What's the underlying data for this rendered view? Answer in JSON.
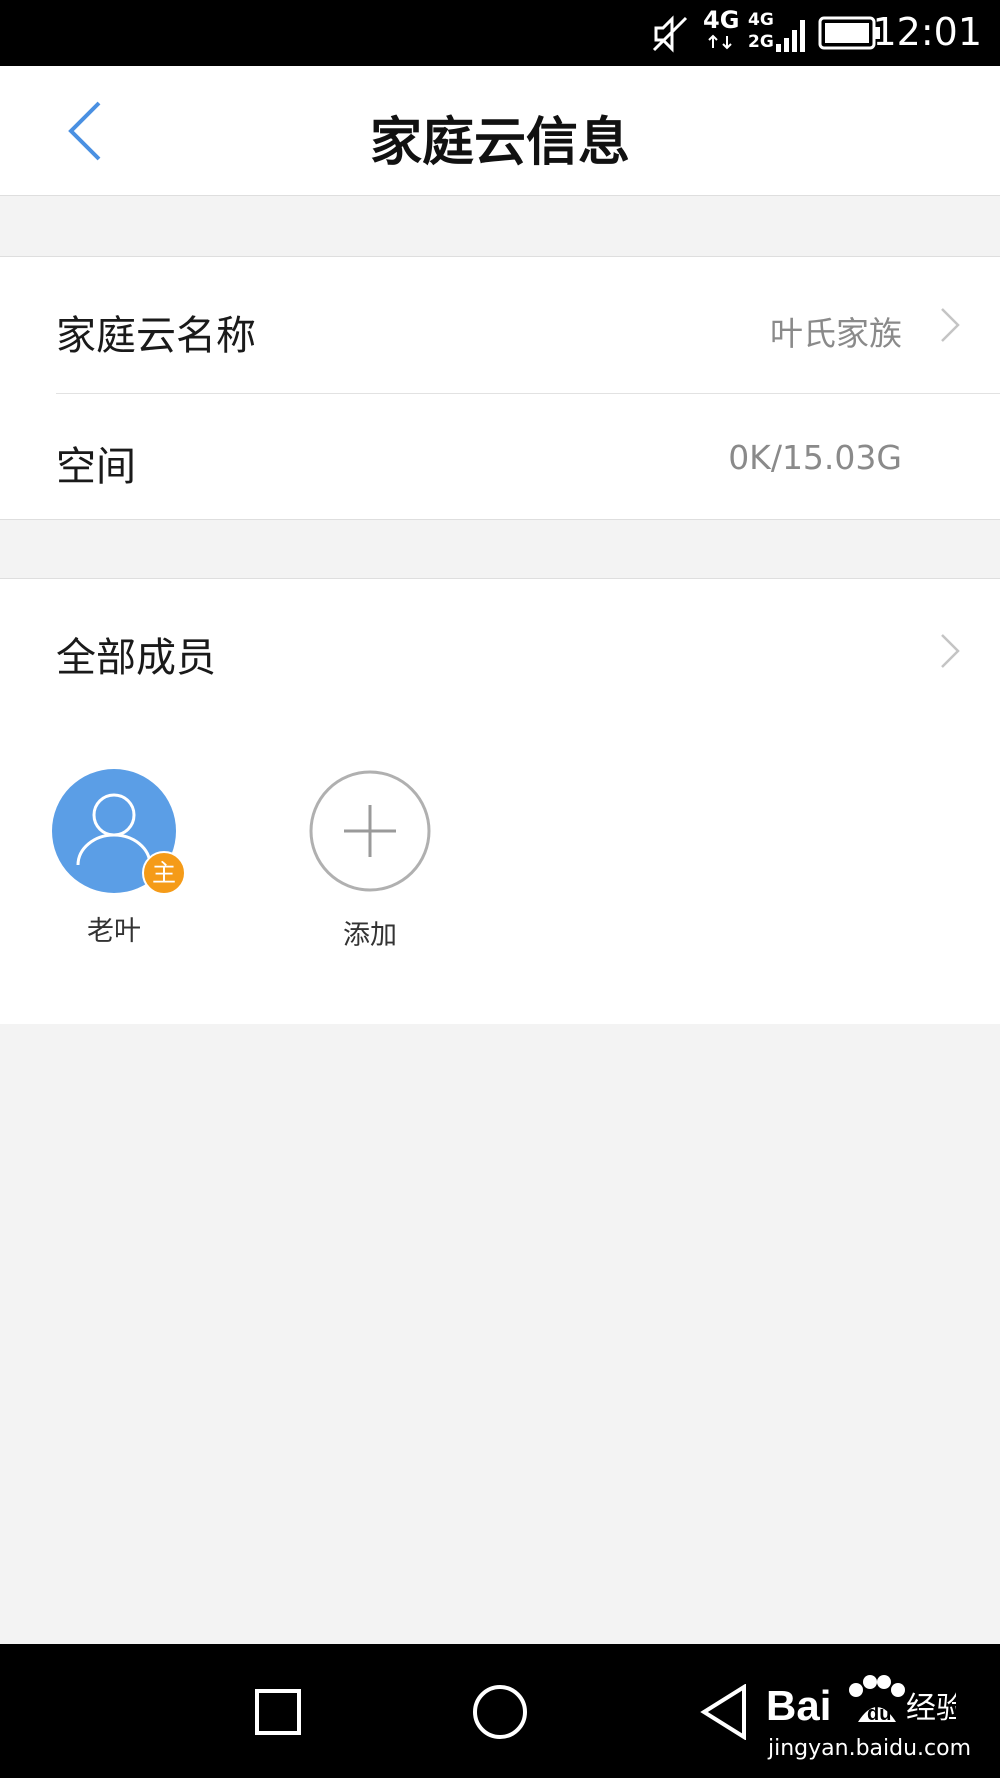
{
  "status_bar": {
    "network_1": "4G",
    "network_2_top": "4G",
    "network_2_bottom": "2G",
    "time": "12:01"
  },
  "header": {
    "title": "家庭云信息"
  },
  "info": {
    "name_label": "家庭云名称",
    "name_value": "叶氏家族",
    "space_label": "空间",
    "space_value": "0K/15.03G"
  },
  "members": {
    "label": "全部成员",
    "list": [
      {
        "name": "老叶",
        "badge": "主"
      }
    ],
    "add_label": "添加"
  },
  "watermark": {
    "logo_text_1": "Bai",
    "logo_text_2": "经验",
    "url": "jingyan.baidu.com"
  },
  "colors": {
    "accent": "#4a90e2",
    "avatar_bg": "#5b9ee6",
    "owner_badge": "#f59b18",
    "page_bg": "#f3f3f3"
  }
}
